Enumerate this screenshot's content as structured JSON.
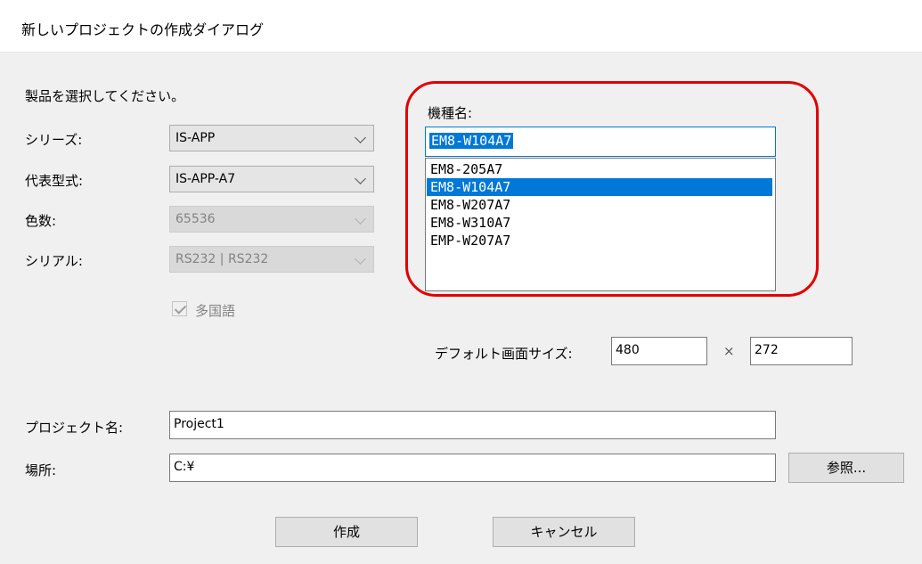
{
  "dialog": {
    "title": "新しいプロジェクトの作成ダイアログ"
  },
  "product": {
    "heading": "製品を選択してください。",
    "series_label": "シリーズ:",
    "series_value": "IS-APP",
    "model_type_label": "代表型式:",
    "model_type_value": "IS-APP-A7",
    "colors_label": "色数:",
    "colors_value": "65536",
    "serial_label": "シリアル:",
    "serial_value": "RS232 | RS232",
    "multilang_label": "多国語",
    "multilang_checked": true
  },
  "model_name": {
    "label": "機種名:",
    "value": "EM8-W104A7",
    "options": [
      "EM8-205A7",
      "EM8-W104A7",
      "EM8-W207A7",
      "EM8-W310A7",
      "EMP-W207A7"
    ],
    "selected_index": 1
  },
  "screen_size": {
    "label": "デフォルト画面サイズ:",
    "width": "480",
    "separator": "×",
    "height": "272"
  },
  "project": {
    "name_label": "プロジェクト名:",
    "name_value": "Project1",
    "location_label": "場所:",
    "location_value": "C:¥",
    "browse_label": "参照..."
  },
  "actions": {
    "create_label": "作成",
    "cancel_label": "キャンセル"
  },
  "colors": {
    "accent": "#0078d7",
    "highlight_ring": "#e30000",
    "client_bg": "#f0f0f0"
  }
}
